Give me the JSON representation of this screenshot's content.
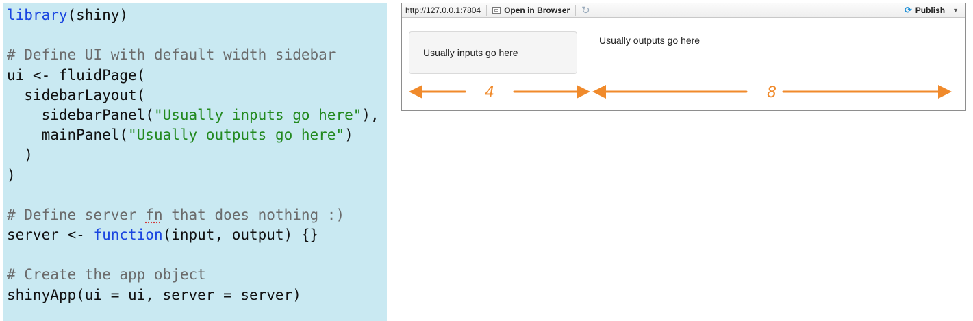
{
  "code_lines": [
    [
      {
        "t": "library",
        "c": "fn"
      },
      {
        "t": "(shiny)",
        "c": "plain"
      }
    ],
    [],
    [
      {
        "t": "# Define UI with default width sidebar",
        "c": "comment"
      }
    ],
    [
      {
        "t": "ui <- fluidPage(",
        "c": "plain"
      }
    ],
    [
      {
        "t": "  sidebarLayout(",
        "c": "plain"
      }
    ],
    [
      {
        "t": "    sidebarPanel(",
        "c": "plain"
      },
      {
        "t": "\"Usually inputs go here\"",
        "c": "str"
      },
      {
        "t": "),",
        "c": "plain"
      }
    ],
    [
      {
        "t": "    mainPanel(",
        "c": "plain"
      },
      {
        "t": "\"Usually outputs go here\"",
        "c": "str"
      },
      {
        "t": ")",
        "c": "plain"
      }
    ],
    [
      {
        "t": "  )",
        "c": "plain"
      }
    ],
    [
      {
        "t": ")",
        "c": "plain"
      }
    ],
    [],
    [
      {
        "t": "# Define server ",
        "c": "comment"
      },
      {
        "t": "fn",
        "c": "squig"
      },
      {
        "t": " that does nothing :)",
        "c": "comment"
      }
    ],
    [
      {
        "t": "server <- ",
        "c": "plain"
      },
      {
        "t": "function",
        "c": "fn"
      },
      {
        "t": "(input, output) {}",
        "c": "plain"
      }
    ],
    [],
    [
      {
        "t": "# Create the app object",
        "c": "comment"
      }
    ],
    [
      {
        "t": "shinyApp(ui = ui, server = server)",
        "c": "plain"
      }
    ]
  ],
  "viewer": {
    "url": "http://127.0.0.1:7804",
    "open_in_browser": "Open in Browser",
    "publish": "Publish",
    "sidebar_text": "Usually inputs go here",
    "main_text": "Usually outputs go here"
  },
  "annotations": {
    "sidebar_width": "4",
    "main_width": "8",
    "color": "#f08a2b"
  },
  "icons": {
    "open_in_browser": "window-icon",
    "refresh": "refresh-icon",
    "publish": "publish-icon",
    "dropdown": "chevron-down-icon"
  }
}
